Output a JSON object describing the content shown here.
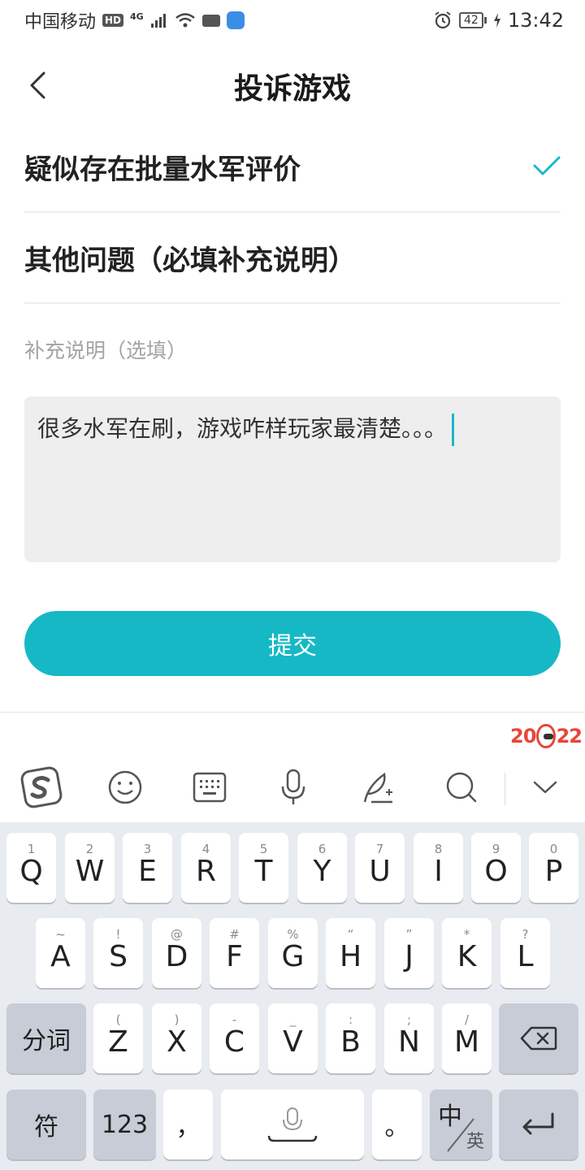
{
  "status_bar": {
    "carrier": "中国移动",
    "hd": "HD",
    "network": "4G",
    "battery": "42",
    "time": "13:42"
  },
  "header": {
    "title": "投诉游戏"
  },
  "options": [
    {
      "label": "疑似存在批量水军评价",
      "selected": true
    },
    {
      "label": "其他问题（必填补充说明）",
      "selected": false
    }
  ],
  "supplement": {
    "label": "补充说明（选填）",
    "value": "很多水军在刷，游戏咋样玩家最清楚。。。"
  },
  "submit_label": "提交",
  "promo_badge": {
    "left": "20",
    "right": "22"
  },
  "keyboard": {
    "row1": [
      {
        "hint": "1",
        "key": "Q"
      },
      {
        "hint": "2",
        "key": "W"
      },
      {
        "hint": "3",
        "key": "E"
      },
      {
        "hint": "4",
        "key": "R"
      },
      {
        "hint": "5",
        "key": "T"
      },
      {
        "hint": "6",
        "key": "Y"
      },
      {
        "hint": "7",
        "key": "U"
      },
      {
        "hint": "8",
        "key": "I"
      },
      {
        "hint": "9",
        "key": "O"
      },
      {
        "hint": "0",
        "key": "P"
      }
    ],
    "row2": [
      {
        "hint": "~",
        "key": "A"
      },
      {
        "hint": "!",
        "key": "S"
      },
      {
        "hint": "@",
        "key": "D"
      },
      {
        "hint": "#",
        "key": "F"
      },
      {
        "hint": "%",
        "key": "G"
      },
      {
        "hint": "“",
        "key": "H"
      },
      {
        "hint": "”",
        "key": "J"
      },
      {
        "hint": "*",
        "key": "K"
      },
      {
        "hint": "?",
        "key": "L"
      }
    ],
    "row3": [
      {
        "hint": "(",
        "key": "Z"
      },
      {
        "hint": ")",
        "key": "X"
      },
      {
        "hint": "-",
        "key": "C"
      },
      {
        "hint": "_",
        "key": "V"
      },
      {
        "hint": ":",
        "key": "B"
      },
      {
        "hint": ";",
        "key": "N"
      },
      {
        "hint": "/",
        "key": "M"
      }
    ],
    "segment_label": "分词",
    "symbol_label": "符",
    "number_label": "123",
    "comma": "，",
    "period": "。",
    "lang_primary": "中",
    "lang_secondary": "英"
  },
  "colors": {
    "accent": "#16b8c6",
    "check": "#1cb8c8",
    "keyboard_bg": "#e8ebf0"
  }
}
